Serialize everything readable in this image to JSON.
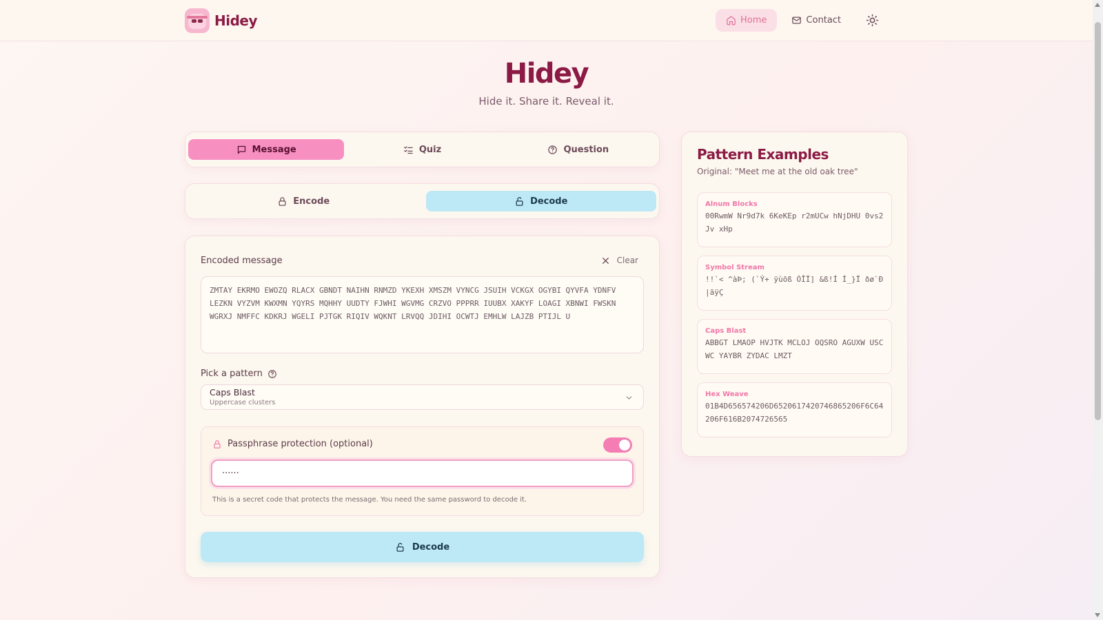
{
  "header": {
    "brand_name": "Hidey",
    "nav": [
      {
        "label": "Home",
        "icon": "home-icon",
        "active": true
      },
      {
        "label": "Contact",
        "icon": "mail-icon",
        "active": false
      }
    ],
    "theme_icon": "sun-icon"
  },
  "hero": {
    "title": "Hidey",
    "subtitle": "Hide it. Share it. Reveal it."
  },
  "mode_tabs": [
    {
      "label": "Message",
      "icon": "message-icon",
      "active": true
    },
    {
      "label": "Quiz",
      "icon": "list-check-icon",
      "active": false
    },
    {
      "label": "Question",
      "icon": "help-circle-icon",
      "active": false
    }
  ],
  "direction_tabs": [
    {
      "label": "Encode",
      "icon": "lock-icon",
      "active": false
    },
    {
      "label": "Decode",
      "icon": "unlock-icon",
      "active": true
    }
  ],
  "form": {
    "encoded_label": "Encoded message",
    "clear_label": "Clear",
    "encoded_value": "ZMTAY EKRMO EWOZQ RLACX GBNDT NAIHN RNMZD YKEXH XMSZM VYNCG JSUIH VCKGX OGYBI QYVFA YDNFV LEZKN VYZVM KWXMN YQYRS MQHHY UUDTY FJWHI WGVMG CRZVO PPPRR IUUBX XAKYF LOAGI XBNWI FWSKN WGRXJ NMFFC KDKRJ WGELI PJTGK RIQIV WQKNT LRVQQ JDIHI OCWTJ EMHLW LAJZB PTIJL U",
    "pattern_label": "Pick a pattern",
    "pattern_selected": "Caps Blast",
    "pattern_selected_desc": "Uppercase clusters",
    "passphrase_label": "Passphrase protection (optional)",
    "passphrase_enabled": true,
    "passphrase_value": "······",
    "passphrase_hint": "This is a secret code that protects the message. You need the same password to decode it.",
    "submit_label": "Decode"
  },
  "examples": {
    "title": "Pattern Examples",
    "original": "Original: \"Meet me at the old oak tree\"",
    "items": [
      {
        "name": "Alnum Blocks",
        "value": "00RwmW Nr9d7k 6KeKEp r2mUCw hNjDHU 0vs2Jv xHp"
      },
      {
        "name": "Symbol Stream",
        "value": "!!`< ^àÞ; (`Ý+ ÿùõß ÓÎÏ] &ß!Í Í_}Ï ðø`Ð |ãÿÇ"
      },
      {
        "name": "Caps Blast",
        "value": "ABBGT LMAOP HVJTK MCLOJ OQSRO AGUXW USCWC YAYBR ZYDAC LMZT"
      },
      {
        "name": "Hex Weave",
        "value": "01B4D656574206D6520617420746865206F6C64206F616B2074726565"
      }
    ]
  }
}
